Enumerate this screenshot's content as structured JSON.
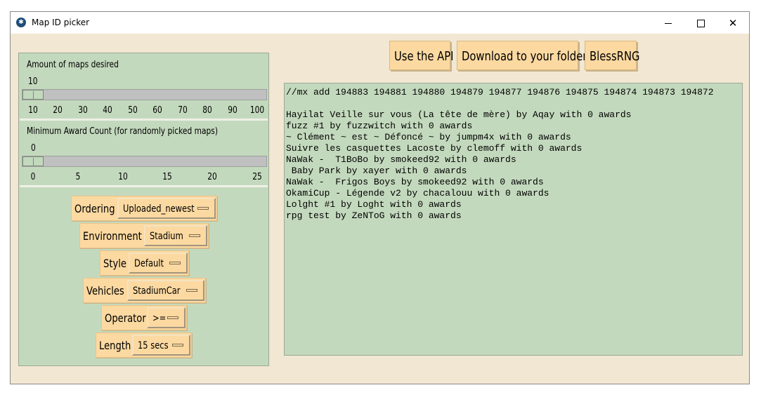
{
  "window": {
    "title": "Map ID picker",
    "icon": "app-icon"
  },
  "slider_maps": {
    "label": "Amount of maps desired",
    "value": "10",
    "ticks": [
      "10",
      "20",
      "30",
      "40",
      "50",
      "60",
      "70",
      "80",
      "90",
      "100"
    ],
    "position": 0
  },
  "slider_awards": {
    "label": "Minimum Award Count (for randomly picked maps)",
    "value": "0",
    "ticks": [
      "0",
      "5",
      "10",
      "15",
      "20",
      "25"
    ],
    "position": 0
  },
  "options": [
    {
      "label": "Ordering",
      "value": "Uploaded_newest"
    },
    {
      "label": "Environment",
      "value": "Stadium"
    },
    {
      "label": "Style",
      "value": "Default"
    },
    {
      "label": "Vehicles",
      "value": "StadiumCar"
    },
    {
      "label": "Operator",
      "value": ">="
    },
    {
      "label": "Length",
      "value": "15 secs"
    }
  ],
  "buttons": {
    "api": "Use the API",
    "download": "Download to your folder",
    "bless": "BlessRNG"
  },
  "output": {
    "lines": [
      "//mx add 194883 194881 194880 194879 194877 194876 194875 194874 194873 194872",
      "",
      "Hayilat Veille sur vous (La tête de mère) by Aqay with 0 awards",
      "fuzz #1 by fuzzwitch with 0 awards",
      "~ Clément ~ est ~ Défoncé ~ by jumpm4x with 0 awards",
      "Suivre les casquettes Lacoste by clemoff with 0 awards",
      "NaWak -  T1BoBo by smokeed92 with 0 awards",
      " Baby Park by xayer with 0 awards",
      "NaWak -  Frigos Boys by smokeed92 with 0 awards",
      "OkamiCup - Légende v2 by chacalouu with 0 awards",
      "Lolght #1 by Loght with 0 awards",
      "rpg test by ZeNToG with 0 awards"
    ]
  },
  "colors": {
    "panel": "#c3d9bd",
    "button": "#fbd9a1",
    "background": "#f2e7d2"
  }
}
